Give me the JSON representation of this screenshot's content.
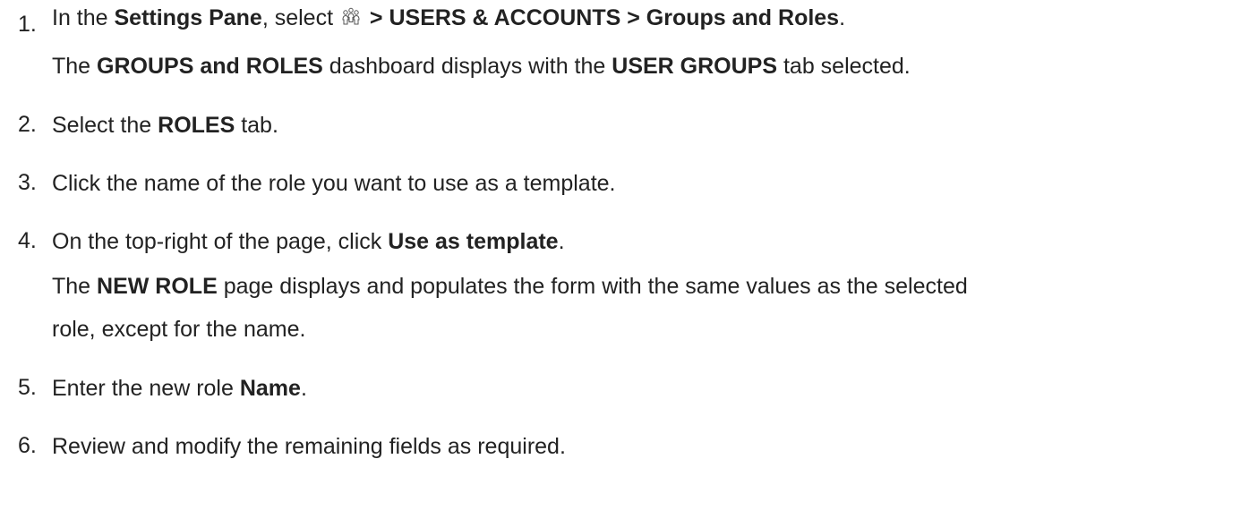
{
  "steps": [
    {
      "number": "1.",
      "parts": {
        "a": "In the ",
        "b": "Settings Pane",
        "c": ", select ",
        "d": " > USERS & ACCOUNTS > Groups and Roles",
        "e": "."
      },
      "icon": "users-group-icon",
      "result": {
        "a": "The ",
        "b": "GROUPS and ROLES",
        "c": " dashboard displays with the ",
        "d": "USER GROUPS",
        "e": " tab selected."
      }
    },
    {
      "number": "2.",
      "parts": {
        "a": "Select the ",
        "b": "ROLES",
        "c": " tab."
      }
    },
    {
      "number": "3.",
      "text": "Click the name of the role you want to use as a template."
    },
    {
      "number": "4.",
      "parts": {
        "a": "On the top-right of the page, click ",
        "b": "Use as template",
        "c": "."
      },
      "result": {
        "a": "The ",
        "b": "NEW ROLE",
        "c": " page displays and populates the form with the same values as the selected",
        "d": "role, except for the name."
      }
    },
    {
      "number": "5.",
      "parts": {
        "a": "Enter the new role ",
        "b": "Name",
        "c": "."
      }
    },
    {
      "number": "6.",
      "text": "Review and modify the remaining fields as required."
    }
  ]
}
